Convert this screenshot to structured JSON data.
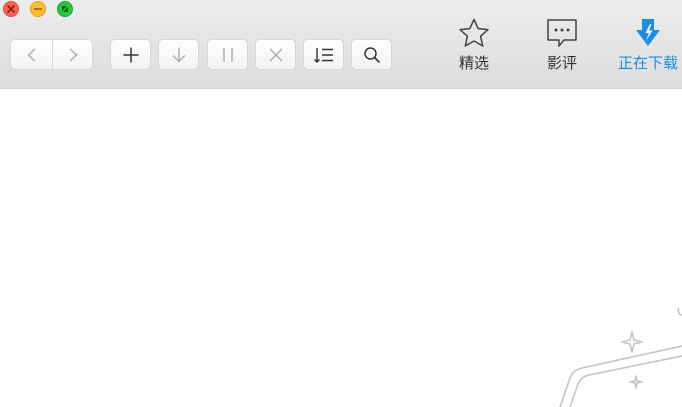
{
  "window": {
    "controls": [
      "close",
      "minimize",
      "zoom"
    ]
  },
  "toolbar": {
    "back_icon": "chevron-left-icon",
    "forward_icon": "chevron-right-icon",
    "add_icon": "plus-icon",
    "download_icon": "arrow-down-icon",
    "pause_icon": "pause-icon",
    "delete_icon": "close-icon",
    "sort_icon": "list-sort-icon",
    "search_icon": "search-icon"
  },
  "nav": {
    "featured_label": "精选",
    "reviews_label": "影评",
    "downloading_label": "正在下载",
    "active_color": "#1a8ee6"
  }
}
